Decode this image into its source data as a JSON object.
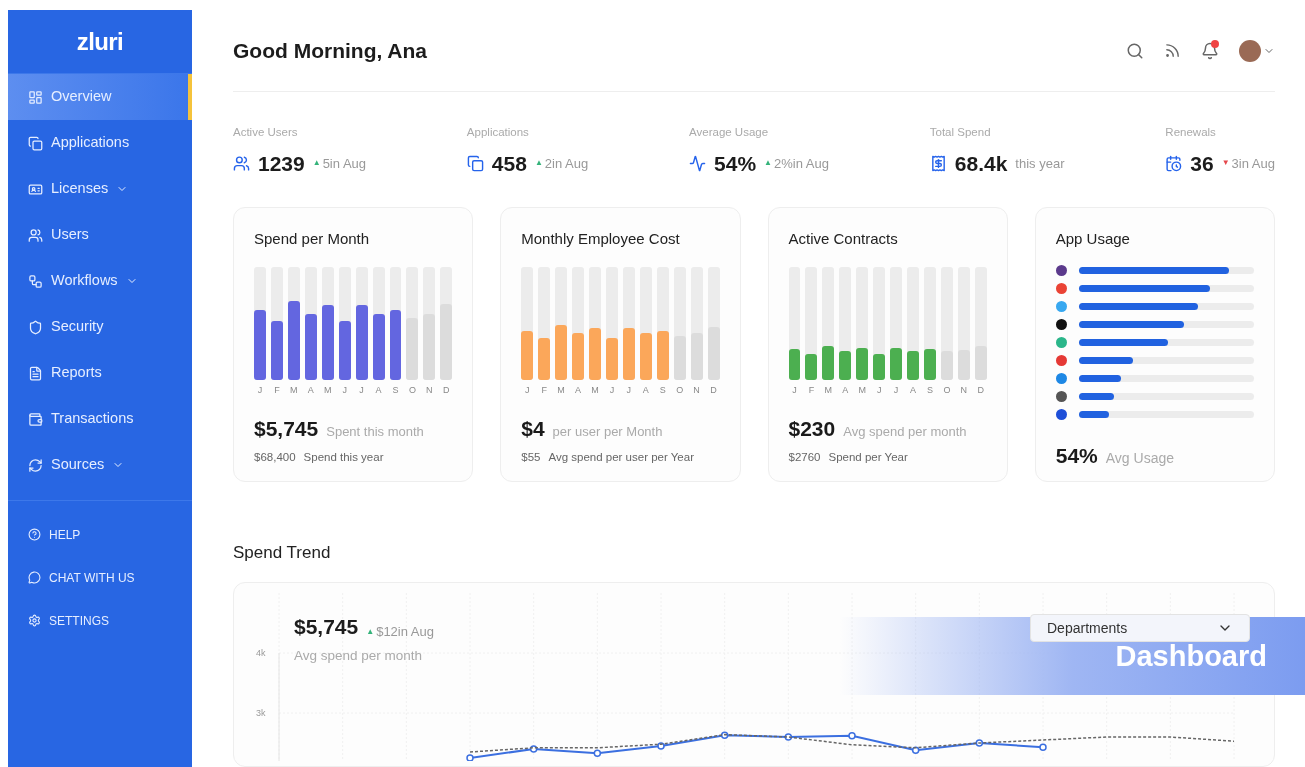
{
  "sidebar": {
    "logo": "zluri",
    "items": [
      {
        "label": "Overview",
        "selected": true,
        "has_submenu": false
      },
      {
        "label": "Applications",
        "selected": false,
        "has_submenu": false
      },
      {
        "label": "Licenses",
        "selected": false,
        "has_submenu": true
      },
      {
        "label": "Users",
        "selected": false,
        "has_submenu": false
      },
      {
        "label": "Workflows",
        "selected": false,
        "has_submenu": true
      },
      {
        "label": "Security",
        "selected": false,
        "has_submenu": false
      },
      {
        "label": "Reports",
        "selected": false,
        "has_submenu": false
      },
      {
        "label": "Transactions",
        "selected": false,
        "has_submenu": false
      },
      {
        "label": "Sources",
        "selected": false,
        "has_submenu": true
      }
    ],
    "footer_items": [
      {
        "label": "HELP"
      },
      {
        "label": "CHAT WITH US"
      },
      {
        "label": "SETTINGS"
      }
    ]
  },
  "header": {
    "greeting": "Good Morning, Ana",
    "has_notification": true
  },
  "stats": [
    {
      "label": "Active Users",
      "value": "1239",
      "arrow": "▲",
      "change": "5in Aug"
    },
    {
      "label": "Applications",
      "value": "458",
      "arrow": "▲",
      "change": "2in Aug"
    },
    {
      "label": "Average Usage",
      "value": "54%",
      "arrow": "▲",
      "change": "2%in Aug"
    },
    {
      "label": "Total Spend",
      "value": "68.4k",
      "change": "this year"
    },
    {
      "label": "Renewals",
      "value": "36",
      "arrow": "▼",
      "change": "3in Aug"
    }
  ],
  "cards": [
    {
      "kind": "bars",
      "title": "Spend per Month",
      "color": "#6366e0",
      "main_value": "$5,745",
      "main_caption": "Spent this month",
      "sub_value": "$68,400",
      "sub_caption": "Spend this year",
      "months": [
        {
          "label": "J",
          "level": 0.62,
          "projected": false
        },
        {
          "label": "F",
          "level": 0.52,
          "projected": false
        },
        {
          "label": "M",
          "level": 0.7,
          "projected": false
        },
        {
          "label": "A",
          "level": 0.58,
          "projected": false
        },
        {
          "label": "M",
          "level": 0.66,
          "projected": false
        },
        {
          "label": "J",
          "level": 0.52,
          "projected": false
        },
        {
          "label": "J",
          "level": 0.66,
          "projected": false
        },
        {
          "label": "A",
          "level": 0.58,
          "projected": false
        },
        {
          "label": "S",
          "level": 0.62,
          "projected": false
        },
        {
          "label": "O",
          "level": 0.55,
          "projected": true
        },
        {
          "label": "N",
          "level": 0.58,
          "projected": true
        },
        {
          "label": "D",
          "level": 0.67,
          "projected": true
        }
      ]
    },
    {
      "kind": "bars",
      "title": "Monthly Employee Cost",
      "color": "#fba75a",
      "main_value": "$4",
      "main_caption": "per user per Month",
      "sub_value": "$55",
      "sub_caption": "Avg spend per user per Year",
      "months": [
        {
          "label": "J",
          "level": 0.43,
          "projected": false
        },
        {
          "label": "F",
          "level": 0.37,
          "projected": false
        },
        {
          "label": "M",
          "level": 0.48,
          "projected": false
        },
        {
          "label": "A",
          "level": 0.41,
          "projected": false
        },
        {
          "label": "M",
          "level": 0.46,
          "projected": false
        },
        {
          "label": "J",
          "level": 0.37,
          "projected": false
        },
        {
          "label": "J",
          "level": 0.46,
          "projected": false
        },
        {
          "label": "A",
          "level": 0.41,
          "projected": false
        },
        {
          "label": "S",
          "level": 0.43,
          "projected": false
        },
        {
          "label": "O",
          "level": 0.39,
          "projected": true
        },
        {
          "label": "N",
          "level": 0.41,
          "projected": true
        },
        {
          "label": "D",
          "level": 0.47,
          "projected": true
        }
      ]
    },
    {
      "kind": "bars",
      "title": "Active Contracts",
      "color": "#4caf50",
      "main_value": "$230",
      "main_caption": "Avg spend per month",
      "sub_value": "$2760",
      "sub_caption": "Spend per Year",
      "months": [
        {
          "label": "J",
          "level": 0.27,
          "projected": false
        },
        {
          "label": "F",
          "level": 0.23,
          "projected": false
        },
        {
          "label": "M",
          "level": 0.3,
          "projected": false
        },
        {
          "label": "A",
          "level": 0.25,
          "projected": false
        },
        {
          "label": "M",
          "level": 0.28,
          "projected": false
        },
        {
          "label": "J",
          "level": 0.23,
          "projected": false
        },
        {
          "label": "J",
          "level": 0.28,
          "projected": false
        },
        {
          "label": "A",
          "level": 0.25,
          "projected": false
        },
        {
          "label": "S",
          "level": 0.27,
          "projected": false
        },
        {
          "label": "O",
          "level": 0.25,
          "projected": true
        },
        {
          "label": "N",
          "level": 0.26,
          "projected": true
        },
        {
          "label": "D",
          "level": 0.3,
          "projected": true
        }
      ]
    },
    {
      "kind": "usage",
      "title": "App Usage",
      "main_value": "54%",
      "main_caption": "Avg Usage",
      "apps": [
        {
          "color": "#5b3a8c",
          "level": 0.86
        },
        {
          "color": "#ea4335",
          "level": 0.75
        },
        {
          "color": "#38a8f0",
          "level": 0.68
        },
        {
          "color": "#111111",
          "level": 0.6
        },
        {
          "color": "#2bb68a",
          "level": 0.51
        },
        {
          "color": "#e53935",
          "level": 0.31
        },
        {
          "color": "#1e88e5",
          "level": 0.24
        },
        {
          "color": "#555555",
          "level": 0.2
        },
        {
          "color": "#1e4fd8",
          "level": 0.17
        }
      ]
    }
  ],
  "trend": {
    "title": "Spend Trend",
    "value": "$5,745",
    "arrow": "▲",
    "change": "$12in Aug",
    "caption": "Avg spend per month",
    "filter": "Departments",
    "chart_data": {
      "type": "line",
      "grid": true,
      "ylim": [
        2200,
        4000
      ],
      "yticks": [
        {
          "value": 3000,
          "label": "3k"
        },
        {
          "value": 4000,
          "label": "4k"
        }
      ],
      "series": [
        {
          "color": "#3b6fe0",
          "marker": true,
          "line_style": "solid",
          "values": [
            null,
            null,
            null,
            2250,
            2400,
            2330,
            2450,
            2630,
            2600,
            2620,
            2380,
            2500,
            2430,
            null,
            null,
            null
          ]
        },
        {
          "color": "#666666",
          "marker": false,
          "line_style": "dashed",
          "values": [
            null,
            null,
            null,
            2350,
            2420,
            2420,
            2480,
            2640,
            2600,
            2470,
            2420,
            2500,
            2550,
            2600,
            2600,
            2530
          ]
        }
      ]
    }
  },
  "banner": "Dashboard"
}
